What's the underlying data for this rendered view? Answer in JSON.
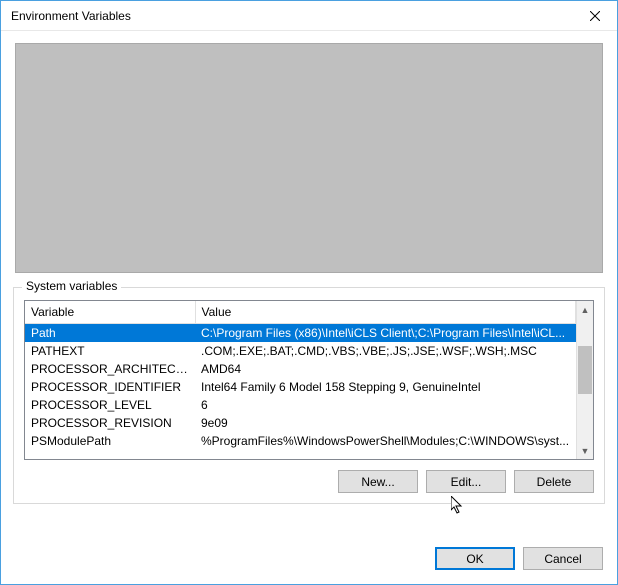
{
  "window": {
    "title": "Environment Variables"
  },
  "system_variables": {
    "label": "System variables",
    "columns": {
      "variable": "Variable",
      "value": "Value"
    },
    "rows": [
      {
        "name": "Path",
        "value": "C:\\Program Files (x86)\\Intel\\iCLS Client\\;C:\\Program Files\\Intel\\iCL...",
        "selected": true
      },
      {
        "name": "PATHEXT",
        "value": ".COM;.EXE;.BAT;.CMD;.VBS;.VBE;.JS;.JSE;.WSF;.WSH;.MSC",
        "selected": false
      },
      {
        "name": "PROCESSOR_ARCHITECTURE",
        "value": "AMD64",
        "selected": false
      },
      {
        "name": "PROCESSOR_IDENTIFIER",
        "value": "Intel64 Family 6 Model 158 Stepping 9, GenuineIntel",
        "selected": false
      },
      {
        "name": "PROCESSOR_LEVEL",
        "value": "6",
        "selected": false
      },
      {
        "name": "PROCESSOR_REVISION",
        "value": "9e09",
        "selected": false
      },
      {
        "name": "PSModulePath",
        "value": "%ProgramFiles%\\WindowsPowerShell\\Modules;C:\\WINDOWS\\syst...",
        "selected": false
      }
    ],
    "buttons": {
      "new": "New...",
      "edit": "Edit...",
      "delete": "Delete"
    }
  },
  "dialog_buttons": {
    "ok": "OK",
    "cancel": "Cancel"
  }
}
